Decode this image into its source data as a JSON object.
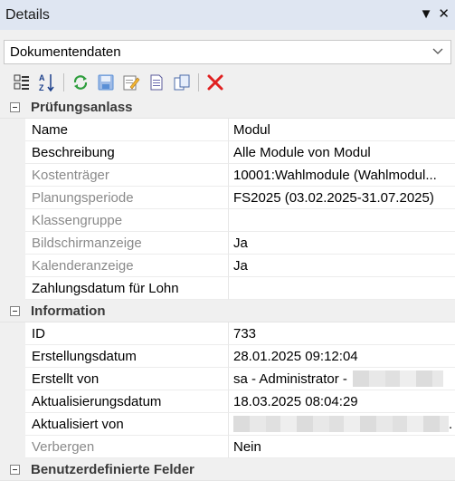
{
  "window": {
    "title": "Details",
    "pin_glyph": "▼",
    "close_glyph": "✕"
  },
  "dropdown": {
    "value": "Dokumentendaten"
  },
  "toolbar": {
    "icons": [
      "categorized-icon",
      "sort-alpha-icon",
      "refresh-icon",
      "save-icon",
      "edit-icon",
      "new-document-icon",
      "copy-icon",
      "delete-icon"
    ],
    "colors": {
      "refresh": "#2f9e3e",
      "delete": "#e02020",
      "save": "#5a8fd6"
    }
  },
  "grid": {
    "sections": [
      {
        "title": "Prüfungsanlass",
        "rows": [
          {
            "name": "Name",
            "value": "Modul"
          },
          {
            "name": "Beschreibung",
            "value": "Alle Module von Modul"
          },
          {
            "name": "Kostenträger",
            "value": "10001:Wahlmodule (Wahlmodul..."
          },
          {
            "name": "Planungsperiode",
            "value": "FS2025 (03.02.2025-31.07.2025)"
          },
          {
            "name": "Klassengruppe",
            "value": ""
          },
          {
            "name": "Bildschirmanzeige",
            "value": "Ja"
          },
          {
            "name": "Kalenderanzeige",
            "value": "Ja"
          },
          {
            "name": "Zahlungsdatum für Lohn",
            "value": ""
          }
        ]
      },
      {
        "title": "Information",
        "rows": [
          {
            "name": "ID",
            "value": "733"
          },
          {
            "name": "Erstellungsdatum",
            "value": "28.01.2025 09:12:04"
          },
          {
            "name": "Erstellt von",
            "value": "sa - Administrator -"
          },
          {
            "name": "Aktualisierungsdatum",
            "value": "18.03.2025 08:04:29"
          },
          {
            "name": "Aktualisiert von",
            "value": "."
          },
          {
            "name": "Verbergen",
            "value": "Nein"
          }
        ]
      },
      {
        "title": "Benutzerdefinierte Felder",
        "rows": []
      }
    ]
  }
}
